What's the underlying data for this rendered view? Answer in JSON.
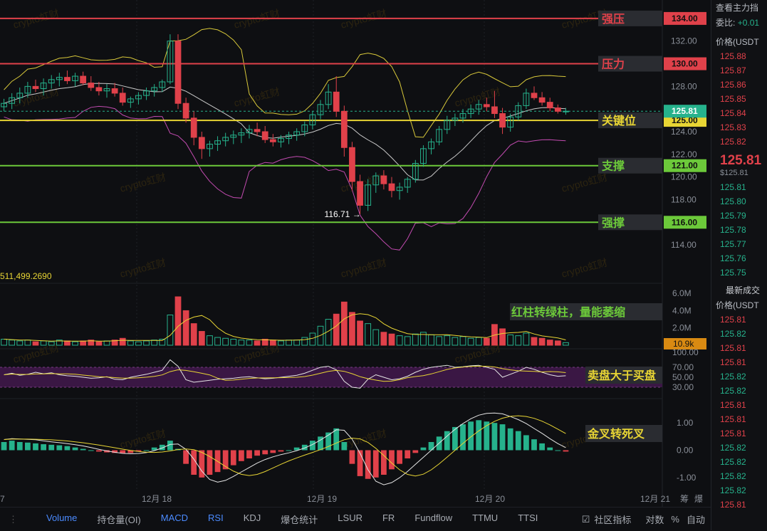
{
  "chart_data": {
    "type": "candlestick",
    "symbol_side": {
      "price_header": "价格(USDT",
      "commission_label": "委比:",
      "commission_value": "+0.01",
      "top_label": "查看主力挡"
    },
    "price_axis": {
      "ticks": [
        "132.00",
        "130.00",
        "128.00",
        "126.00",
        "125.00",
        "124.00",
        "122.00",
        "120.00",
        "118.00",
        "116.00",
        "114.00"
      ],
      "ylim": [
        113,
        135
      ]
    },
    "x_labels": [
      "7",
      "12月 18",
      "12月 19",
      "12月 20",
      "12月 21"
    ],
    "last_price": "125.81",
    "low_annotation": "116.71 →",
    "levels": [
      {
        "label": "强压",
        "value": "134.00",
        "price": 134,
        "color": "#e0414a"
      },
      {
        "label": "压力",
        "value": "130.00",
        "price": 130,
        "color": "#e0414a"
      },
      {
        "label": "关键位",
        "value": "125.00",
        "price": 125,
        "color": "#e8d534"
      },
      {
        "label": "支撑",
        "value": "121.00",
        "price": 121,
        "color": "#6cc93a"
      },
      {
        "label": "强撑",
        "value": "116.00",
        "price": 116,
        "color": "#6cc93a"
      }
    ],
    "candles": [
      [
        126.2,
        126.9,
        125.8,
        126.5
      ],
      [
        126.5,
        127.4,
        126.0,
        127.0
      ],
      [
        127.0,
        127.9,
        126.5,
        127.4
      ],
      [
        127.4,
        128.4,
        127.0,
        128.0
      ],
      [
        128.0,
        128.6,
        127.5,
        127.8
      ],
      [
        127.8,
        128.7,
        127.2,
        128.3
      ],
      [
        128.3,
        129.0,
        127.8,
        128.6
      ],
      [
        128.6,
        129.2,
        128.0,
        128.8
      ],
      [
        128.8,
        129.4,
        128.2,
        128.5
      ],
      [
        128.5,
        129.2,
        128.0,
        128.9
      ],
      [
        128.9,
        129.3,
        128.1,
        128.3
      ],
      [
        128.3,
        128.9,
        127.6,
        127.9
      ],
      [
        127.9,
        128.4,
        127.2,
        127.6
      ],
      [
        127.6,
        128.2,
        127.0,
        127.8
      ],
      [
        127.8,
        128.3,
        127.1,
        127.4
      ],
      [
        127.4,
        127.9,
        126.3,
        126.6
      ],
      [
        126.6,
        127.1,
        126.1,
        126.9
      ],
      [
        126.9,
        127.5,
        126.4,
        127.2
      ],
      [
        127.2,
        127.9,
        126.8,
        127.6
      ],
      [
        127.6,
        128.2,
        127.1,
        127.9
      ],
      [
        127.9,
        128.6,
        127.5,
        128.4
      ],
      [
        128.4,
        132.6,
        128.2,
        132.0
      ],
      [
        132.0,
        132.6,
        126.0,
        126.5
      ],
      [
        126.5,
        127.0,
        124.8,
        125.2
      ],
      [
        125.2,
        125.8,
        122.8,
        123.5
      ],
      [
        123.5,
        124.0,
        121.6,
        122.5
      ],
      [
        122.5,
        123.2,
        121.8,
        122.9
      ],
      [
        122.9,
        123.6,
        122.3,
        123.2
      ],
      [
        123.2,
        123.9,
        122.7,
        123.5
      ],
      [
        123.5,
        124.1,
        122.9,
        123.7
      ],
      [
        123.7,
        124.3,
        123.0,
        123.9
      ],
      [
        123.9,
        124.6,
        123.4,
        124.2
      ],
      [
        124.2,
        124.8,
        123.6,
        124.0
      ],
      [
        124.0,
        124.5,
        123.0,
        123.3
      ],
      [
        123.3,
        123.8,
        122.7,
        123.1
      ],
      [
        123.1,
        123.7,
        122.6,
        123.4
      ],
      [
        123.4,
        124.0,
        122.9,
        123.7
      ],
      [
        123.7,
        124.3,
        123.2,
        124.0
      ],
      [
        124.0,
        124.9,
        123.6,
        124.6
      ],
      [
        124.6,
        125.8,
        124.2,
        125.5
      ],
      [
        125.5,
        126.8,
        125.1,
        126.4
      ],
      [
        126.4,
        128.2,
        126.0,
        127.5
      ],
      [
        127.5,
        128.9,
        125.3,
        125.8
      ],
      [
        125.8,
        126.3,
        121.8,
        122.6
      ],
      [
        122.6,
        123.1,
        118.8,
        119.6
      ],
      [
        119.6,
        120.2,
        116.71,
        117.5
      ],
      [
        117.5,
        119.8,
        117.0,
        119.3
      ],
      [
        119.3,
        120.4,
        118.6,
        120.1
      ],
      [
        120.1,
        120.6,
        118.9,
        119.4
      ],
      [
        119.4,
        120.0,
        118.2,
        118.8
      ],
      [
        118.8,
        119.5,
        118.0,
        119.1
      ],
      [
        119.1,
        120.0,
        118.6,
        119.8
      ],
      [
        119.8,
        121.5,
        119.5,
        121.2
      ],
      [
        121.2,
        122.8,
        120.9,
        122.5
      ],
      [
        122.5,
        123.4,
        122.0,
        123.1
      ],
      [
        123.1,
        124.5,
        122.8,
        124.2
      ],
      [
        124.2,
        125.4,
        123.8,
        125.0
      ],
      [
        125.0,
        125.6,
        124.5,
        125.2
      ],
      [
        125.2,
        126.0,
        124.8,
        125.6
      ],
      [
        125.6,
        126.4,
        125.2,
        126.0
      ],
      [
        126.0,
        126.8,
        125.5,
        126.4
      ],
      [
        126.4,
        127.0,
        125.8,
        126.2
      ],
      [
        126.2,
        127.6,
        125.2,
        125.6
      ],
      [
        125.6,
        126.1,
        123.8,
        124.4
      ],
      [
        124.4,
        125.6,
        124.0,
        125.3
      ],
      [
        125.3,
        126.6,
        125.0,
        126.3
      ],
      [
        126.3,
        127.8,
        126.0,
        127.4
      ],
      [
        127.4,
        128.0,
        126.8,
        127.0
      ],
      [
        127.0,
        127.5,
        126.3,
        126.6
      ],
      [
        126.6,
        127.0,
        125.8,
        126.1
      ],
      [
        126.1,
        126.4,
        125.6,
        125.8
      ],
      [
        125.8,
        126.1,
        125.5,
        125.81
      ]
    ],
    "volume": {
      "label": "511,499.2690",
      "ticks": [
        "6.0M",
        "4.0M",
        "2.0M"
      ],
      "last": "10.9k",
      "annotation": "红柱转绿柱，量能萎缩",
      "values": [
        0.7,
        0.6,
        0.5,
        0.6,
        0.4,
        0.5,
        0.4,
        0.6,
        0.5,
        0.4,
        0.5,
        0.6,
        0.4,
        0.5,
        0.6,
        0.8,
        0.5,
        0.4,
        0.5,
        0.6,
        0.7,
        3.5,
        5.6,
        4.0,
        2.5,
        1.6,
        1.1,
        0.9,
        0.8,
        0.7,
        0.6,
        0.6,
        0.5,
        0.7,
        0.6,
        0.5,
        0.6,
        0.6,
        0.9,
        1.4,
        2.2,
        3.0,
        3.6,
        5.0,
        3.8,
        2.8,
        2.5,
        1.8,
        1.5,
        1.3,
        1.1,
        1.0,
        1.3,
        1.5,
        1.2,
        1.0,
        1.1,
        0.9,
        1.0,
        0.8,
        0.9,
        0.8,
        2.4,
        1.9,
        1.2,
        1.1,
        1.4,
        0.9,
        0.8,
        0.6,
        0.5,
        0.3
      ]
    },
    "rsi": {
      "ticks": [
        "100.00",
        "70.00",
        "50.00",
        "30.00"
      ],
      "annotation": "卖盘大于买盘",
      "values": [
        55,
        58,
        54,
        56,
        60,
        57,
        59,
        55,
        53,
        52,
        50,
        48,
        49,
        51,
        46,
        45,
        50,
        53,
        56,
        60,
        64,
        85,
        72,
        45,
        40,
        42,
        44,
        46,
        47,
        48,
        50,
        51,
        49,
        47,
        48,
        50,
        52,
        54,
        58,
        64,
        70,
        72,
        65,
        42,
        30,
        28,
        46,
        55,
        50,
        45,
        47,
        52,
        60,
        66,
        70,
        72,
        74,
        70,
        71,
        73,
        74,
        70,
        66,
        50,
        56,
        62,
        70,
        66,
        60,
        55,
        52,
        53
      ]
    },
    "macd": {
      "ticks": [
        "1.00",
        "0.00",
        "-1.00"
      ],
      "annotation": "金叉转死叉",
      "values": [
        0.3,
        0.35,
        0.3,
        0.28,
        0.25,
        0.22,
        0.2,
        0.18,
        0.15,
        0.1,
        0.05,
        0.0,
        -0.05,
        -0.08,
        -0.1,
        -0.12,
        -0.1,
        -0.05,
        0.0,
        0.1,
        0.2,
        0.35,
        0.05,
        -0.5,
        -0.9,
        -1.0,
        -0.9,
        -0.8,
        -0.7,
        -0.55,
        -0.4,
        -0.3,
        -0.2,
        -0.15,
        -0.1,
        -0.05,
        0.0,
        0.1,
        0.2,
        0.35,
        0.5,
        0.65,
        0.8,
        0.3,
        -0.5,
        -0.95,
        -1.05,
        -1.0,
        -0.9,
        -0.7,
        -0.5,
        -0.3,
        -0.1,
        0.1,
        0.3,
        0.5,
        0.7,
        0.85,
        0.95,
        1.05,
        1.1,
        1.05,
        1.0,
        0.95,
        0.8,
        0.7,
        0.55,
        0.4,
        0.25,
        0.1,
        0.0,
        -0.05
      ]
    },
    "watermark": "crypto虹财"
  },
  "side": {
    "asks": [
      "125.88",
      "125.87",
      "125.86",
      "125.85",
      "125.84",
      "125.83",
      "125.82"
    ],
    "last": "125.81",
    "last_sub": "$125.81",
    "bids": [
      "125.81",
      "125.80",
      "125.79",
      "125.78",
      "125.77",
      "125.76",
      "125.75"
    ],
    "trades_title": "最新成交",
    "trades_header": "价格(USDT",
    "trades": [
      {
        "p": "125.81",
        "c": "#e0414a"
      },
      {
        "p": "125.82",
        "c": "#26b28c"
      },
      {
        "p": "125.81",
        "c": "#e0414a"
      },
      {
        "p": "125.81",
        "c": "#e0414a"
      },
      {
        "p": "125.82",
        "c": "#26b28c"
      },
      {
        "p": "125.82",
        "c": "#26b28c"
      },
      {
        "p": "125.81",
        "c": "#e0414a"
      },
      {
        "p": "125.81",
        "c": "#e0414a"
      },
      {
        "p": "125.81",
        "c": "#e0414a"
      },
      {
        "p": "125.82",
        "c": "#26b28c"
      },
      {
        "p": "125.82",
        "c": "#26b28c"
      },
      {
        "p": "125.82",
        "c": "#26b28c"
      },
      {
        "p": "125.82",
        "c": "#26b28c"
      },
      {
        "p": "125.81",
        "c": "#e0414a"
      }
    ]
  },
  "bottom": {
    "tabs": [
      "Volume",
      "持仓量(OI)",
      "MACD",
      "RSI",
      "KDJ",
      "爆仓统计",
      "LSUR",
      "FR",
      "Fundflow",
      "TTMU",
      "TTSI"
    ],
    "community": "社区指标",
    "right": [
      "对数",
      "%",
      "自动"
    ],
    "axis_right": [
      "筹",
      "爆"
    ]
  }
}
